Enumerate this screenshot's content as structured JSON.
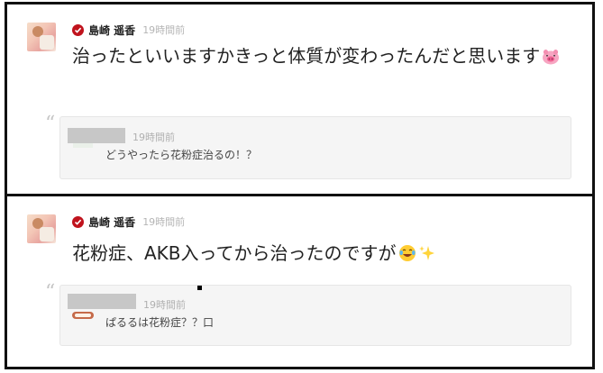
{
  "posts": [
    {
      "author": "島崎 遥香",
      "time": "19時間前",
      "text": "治ったといいますかきっと体質が変わったんだと思います",
      "emojis": [
        "pig-face-emoji"
      ],
      "quote": {
        "time": "19時間前",
        "text": "どうやったら花粉症治るの！？"
      }
    },
    {
      "author": "島崎 遥香",
      "time": "19時間前",
      "text": "花粉症、AKB入ってから治ったのですが",
      "emojis": [
        "laughing-tears-emoji",
        "sparkles-emoji"
      ],
      "quote": {
        "time": "19時間前",
        "text": "ぱるるは花粉症？？口"
      }
    }
  ],
  "colors": {
    "verified_badge": "#c0131d",
    "time_text": "#b5b5b5",
    "quote_bg": "#f5f5f5",
    "post_border": "#111111"
  }
}
